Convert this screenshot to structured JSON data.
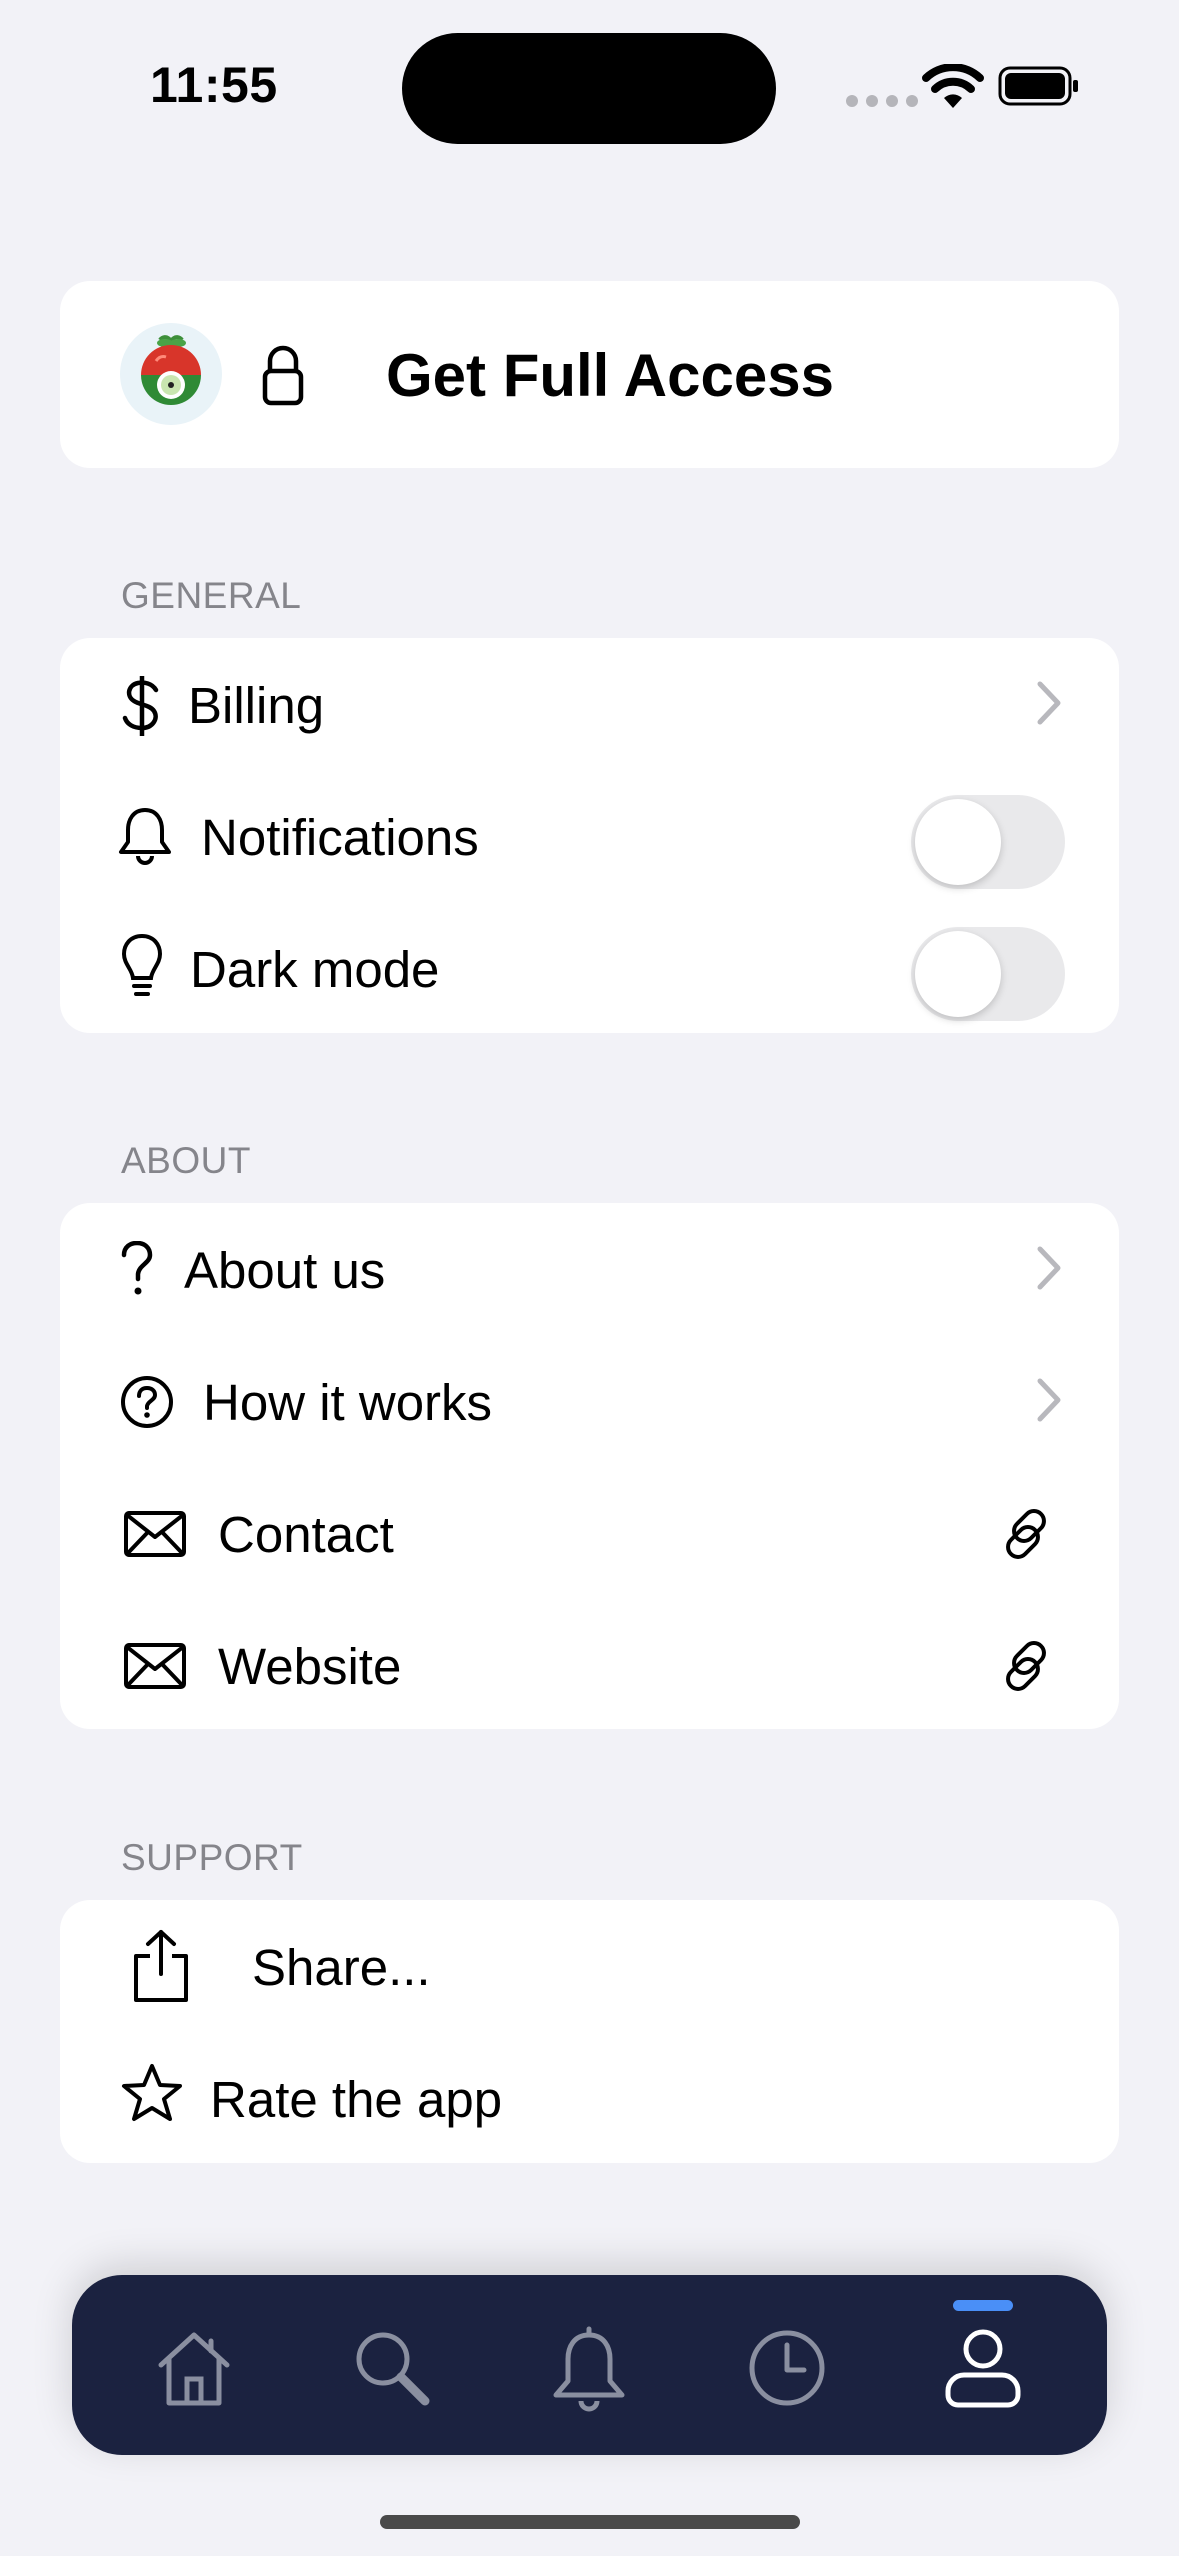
{
  "status_bar": {
    "time": "11:55"
  },
  "access_card": {
    "title": "Get Full Access"
  },
  "general": {
    "header": "GENERAL",
    "billing": "Billing",
    "notifications": "Notifications",
    "notifications_on": false,
    "dark_mode": "Dark mode",
    "dark_mode_on": false
  },
  "about": {
    "header": "ABOUT",
    "about_us": "About us",
    "how_it_works": "How it works",
    "contact": "Contact",
    "website": "Website"
  },
  "support": {
    "header": "SUPPORT",
    "share": "Share...",
    "rate": "Rate the app"
  },
  "tab_bar": {
    "tabs": [
      "home-icon",
      "search-icon",
      "bell-icon",
      "clock-icon",
      "person-icon"
    ],
    "active_tab": "person-icon"
  },
  "colors": {
    "background": "#f2f2f7",
    "tab_bar": "#1b2240",
    "tab_active_indicator": "#4a8ff7"
  }
}
